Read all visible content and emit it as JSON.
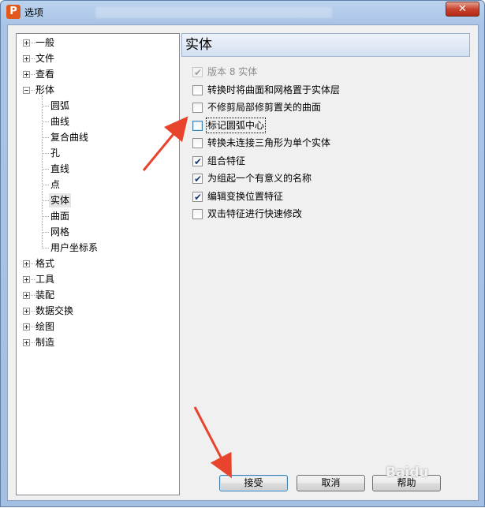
{
  "window": {
    "title": "选项",
    "app_icon_letter": "P",
    "close_glyph": "✕"
  },
  "tree": {
    "items": [
      {
        "label": "一般",
        "level": 0,
        "expander": "plus"
      },
      {
        "label": "文件",
        "level": 0,
        "expander": "plus"
      },
      {
        "label": "查看",
        "level": 0,
        "expander": "plus"
      },
      {
        "label": "形体",
        "level": 0,
        "expander": "minus"
      },
      {
        "label": "圆弧",
        "level": 1
      },
      {
        "label": "曲线",
        "level": 1
      },
      {
        "label": "复合曲线",
        "level": 1
      },
      {
        "label": "孔",
        "level": 1
      },
      {
        "label": "直线",
        "level": 1
      },
      {
        "label": "点",
        "level": 1
      },
      {
        "label": "实体",
        "level": 1,
        "selected": true
      },
      {
        "label": "曲面",
        "level": 1
      },
      {
        "label": "网格",
        "level": 1
      },
      {
        "label": "用户坐标系",
        "level": 1
      },
      {
        "label": "格式",
        "level": 0,
        "expander": "plus"
      },
      {
        "label": "工具",
        "level": 0,
        "expander": "plus"
      },
      {
        "label": "装配",
        "level": 0,
        "expander": "plus"
      },
      {
        "label": "数据交换",
        "level": 0,
        "expander": "plus"
      },
      {
        "label": "绘图",
        "level": 0,
        "expander": "plus"
      },
      {
        "label": "制造",
        "level": 0,
        "expander": "plus"
      }
    ]
  },
  "panel": {
    "title": "实体",
    "options": [
      {
        "label": "版本 8 实体",
        "checked": true,
        "disabled": true
      },
      {
        "label": "转换时将曲面和网格置于实体层",
        "checked": false
      },
      {
        "label": "不修剪局部修剪置关的曲面",
        "checked": false
      },
      {
        "label": "标记圆弧中心",
        "checked": false,
        "focused": true
      },
      {
        "label": "转换未连接三角形为单个实体",
        "checked": false
      },
      {
        "label": "组合特征",
        "checked": true
      },
      {
        "label": "为组起一个有意义的名称",
        "checked": true
      },
      {
        "label": "编辑变换位置特征",
        "checked": true
      },
      {
        "label": "双击特征进行快速修改",
        "checked": false
      }
    ]
  },
  "buttons": {
    "accept": "接受",
    "cancel": "取消",
    "help": "帮助"
  },
  "watermark": "Baidu",
  "colors": {
    "annotation_arrow": "#e8432d",
    "app_icon": "#e2591e"
  }
}
